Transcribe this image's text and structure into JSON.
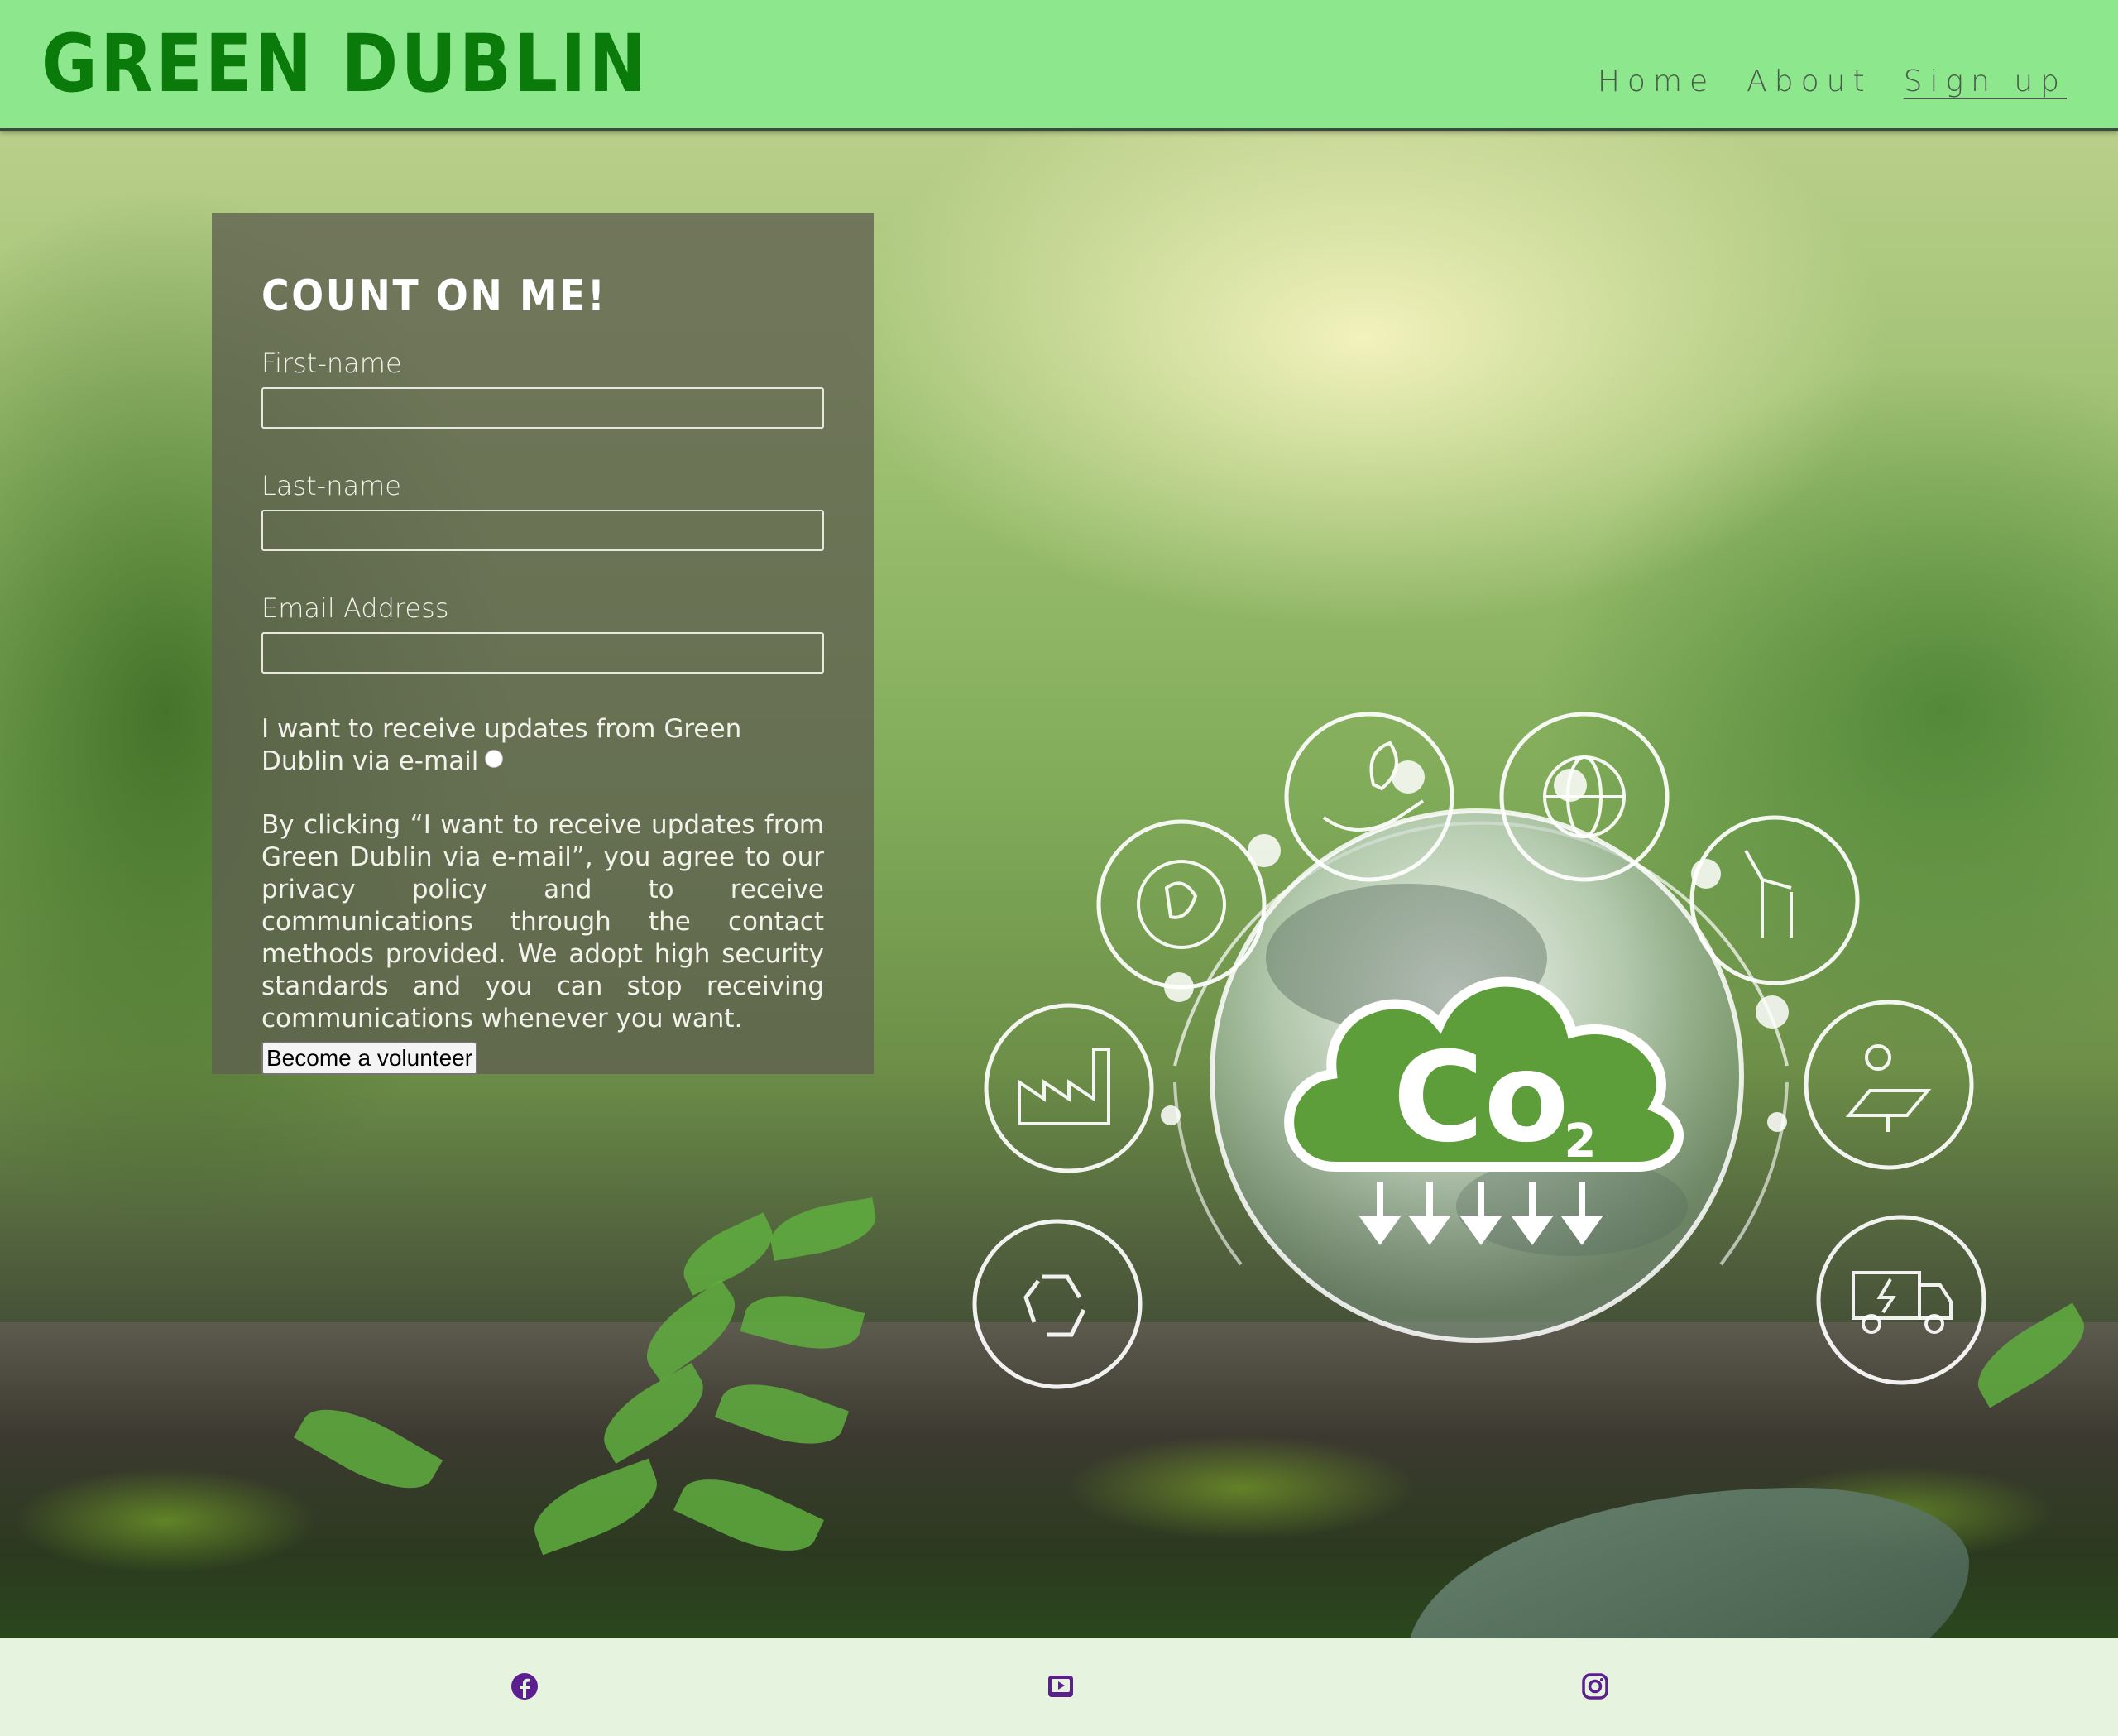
{
  "header": {
    "title": "GREEN DUBLIN",
    "nav": [
      {
        "label": "Home"
      },
      {
        "label": "About"
      },
      {
        "label": "Sign up"
      }
    ]
  },
  "form": {
    "heading": "COUNT ON ME!",
    "first_name_label": "First-name",
    "last_name_label": "Last-name",
    "email_label": "Email Address",
    "updates_label": "I want to receive updates from Green Dublin via e-mail",
    "policy_text": "By clicking “I want to receive updates from Green Dublin via e-mail”, you agree to our privacy policy and to receive communications through the contact methods provided. We adopt high security standards and you can stop receiving communications whenever you want.",
    "submit_label": "Become a volunteer"
  },
  "hero_graphic": {
    "center_text": "Co",
    "subscript": "2",
    "icons": [
      "hand-leaf-icon",
      "globe-icon",
      "wind-turbine-icon",
      "solar-panel-icon",
      "electric-truck-icon",
      "recycle-icon",
      "factory-icon",
      "eco-globe-icon"
    ]
  },
  "footer": {
    "icons": [
      "facebook-icon",
      "youtube-icon",
      "instagram-icon"
    ]
  },
  "colors": {
    "header_bg": "#8de88d",
    "title_green": "#0a7a0a",
    "footer_bg": "#e6f4df",
    "social_icon": "#5b1f8f"
  }
}
